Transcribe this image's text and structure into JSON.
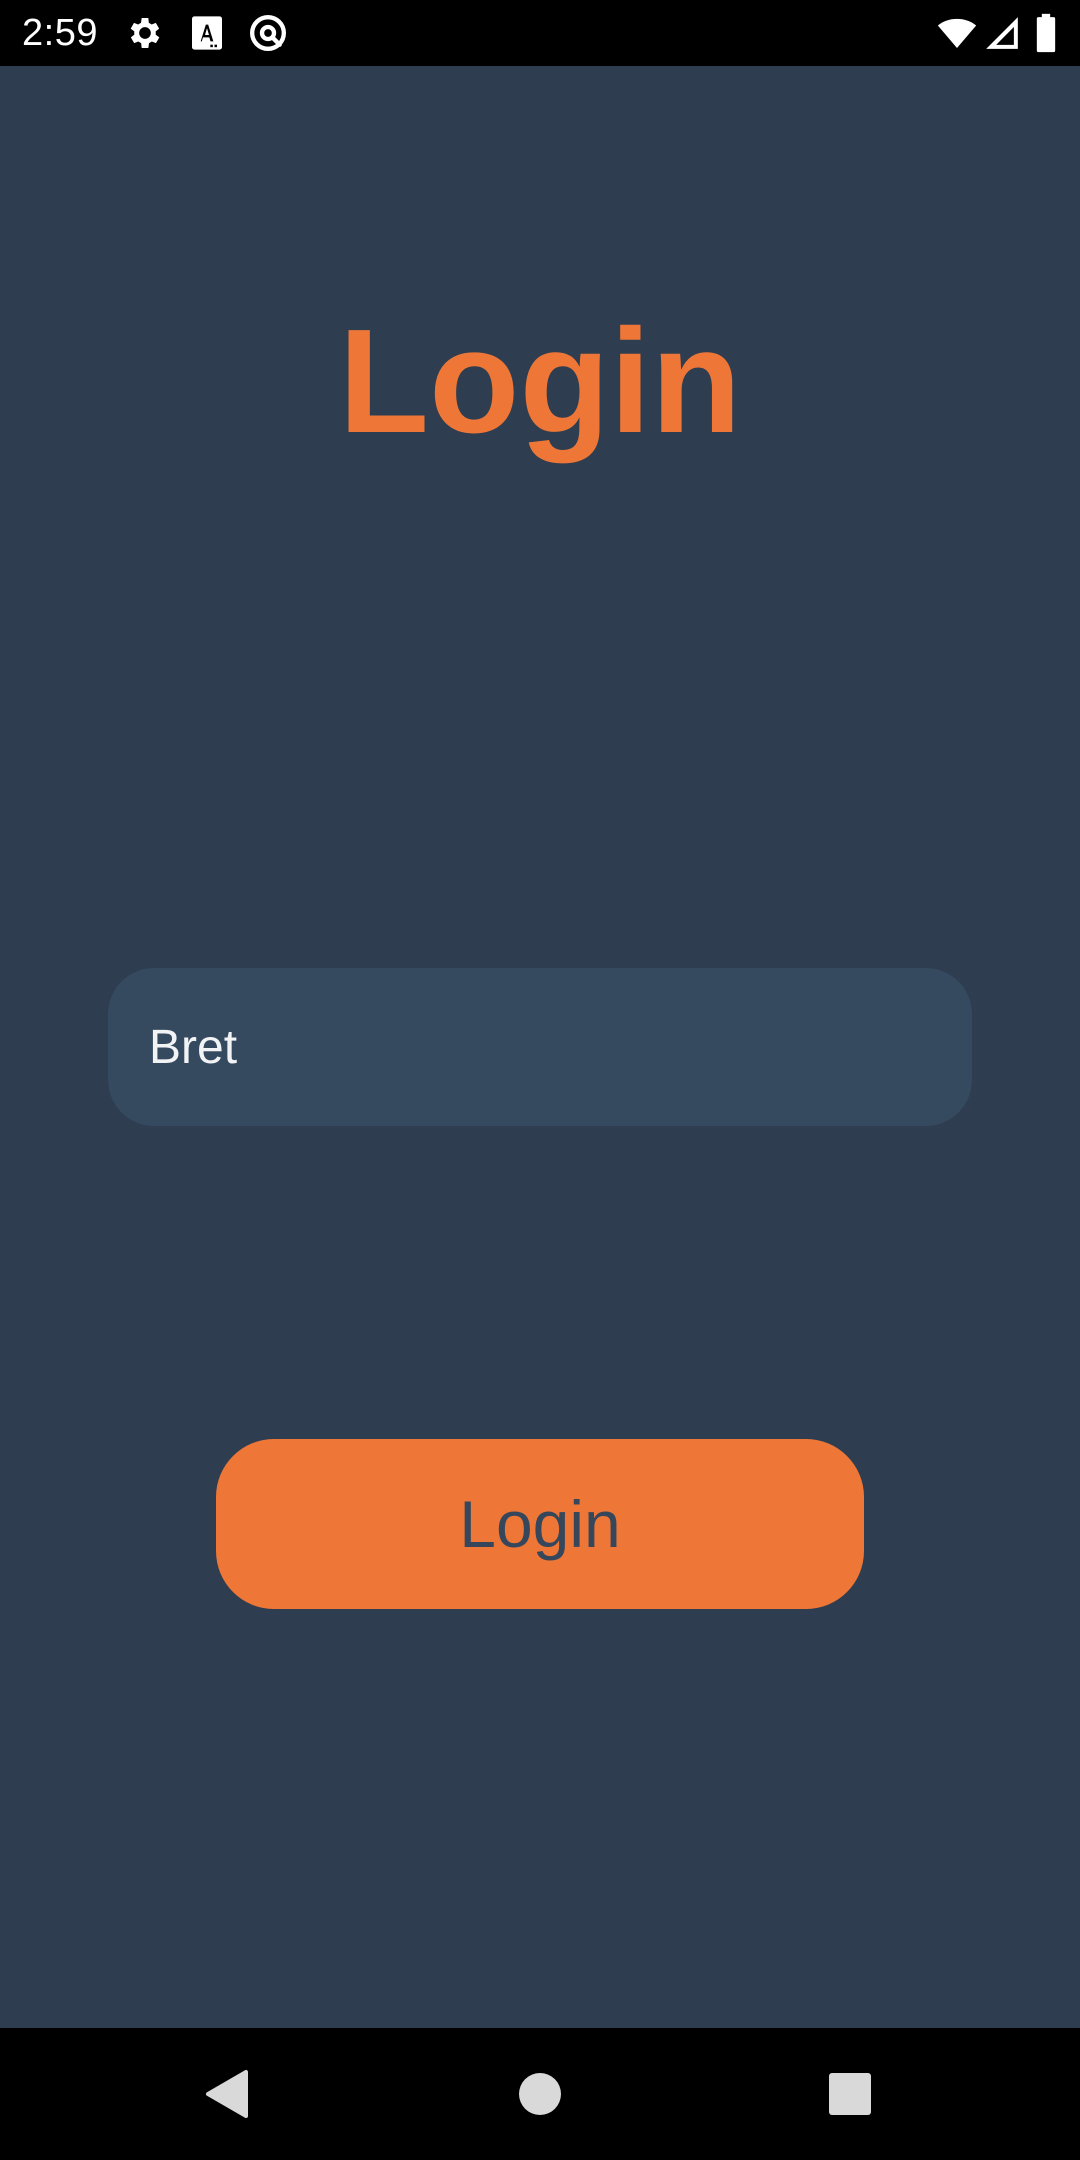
{
  "status_bar": {
    "time": "2:59",
    "left_icons": [
      "gear-icon",
      "text-a-icon",
      "at-sign-icon"
    ],
    "right_icons": [
      "wifi-icon",
      "cellular-signal-icon",
      "battery-icon"
    ]
  },
  "app": {
    "title": "Login",
    "username_input": {
      "value": "Bret",
      "placeholder": ""
    },
    "login_button_label": "Login",
    "colors": {
      "background": "#2e3d50",
      "accent": "#ee7737",
      "input_background": "#35495f",
      "button_text": "#36475c"
    }
  },
  "nav_bar": {
    "buttons": [
      "back-icon",
      "home-icon",
      "recents-icon"
    ]
  }
}
